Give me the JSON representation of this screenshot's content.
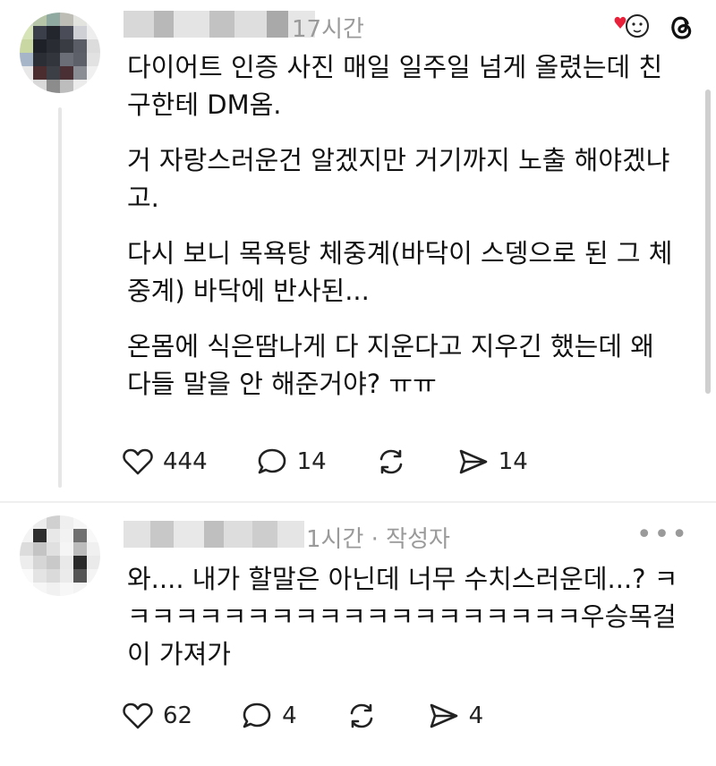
{
  "post1": {
    "time": "17시간",
    "paragraphs": [
      "다이어트 인증 사진 매일 일주일 넘게 올렸는데 친구한테 DM옴.",
      "거 자랑스러운건 알겠지만 거기까지 노출 해야겠냐고.",
      "다시 보니 목욕탕 체중계(바닥이 스뎅으로 된 그 체중계) 바닥에 반사된...",
      "온몸에 식은땀나게 다 지운다고 지우긴 했는데 왜 다들 말을 안 해준거야? ㅠㅠ"
    ],
    "likes": "444",
    "comments": "14",
    "reposts": "",
    "shares": "14"
  },
  "post2": {
    "time": "1시간 · 작성자",
    "more": "•••",
    "paragraphs": [
      "와.... 내가 할말은 아닌데 너무 수치스러운데...? ㅋㅋㅋㅋㅋㅋㅋㅋㅋㅋㅋㅋㅋㅋㅋㅋㅋㅋㅋㅋ우승목걸이 가져가"
    ],
    "likes": "62",
    "comments": "4",
    "shares": "4"
  },
  "icons": {
    "like": "heart-icon",
    "comment": "comment-bubble-icon",
    "repost": "repost-icon",
    "share": "send-icon",
    "brand": "threads-logo-icon",
    "reaction": "heart-face-reaction-icon"
  },
  "colors": {
    "heart_red": "#e8203a",
    "meta_gray": "#9a9a9a"
  }
}
